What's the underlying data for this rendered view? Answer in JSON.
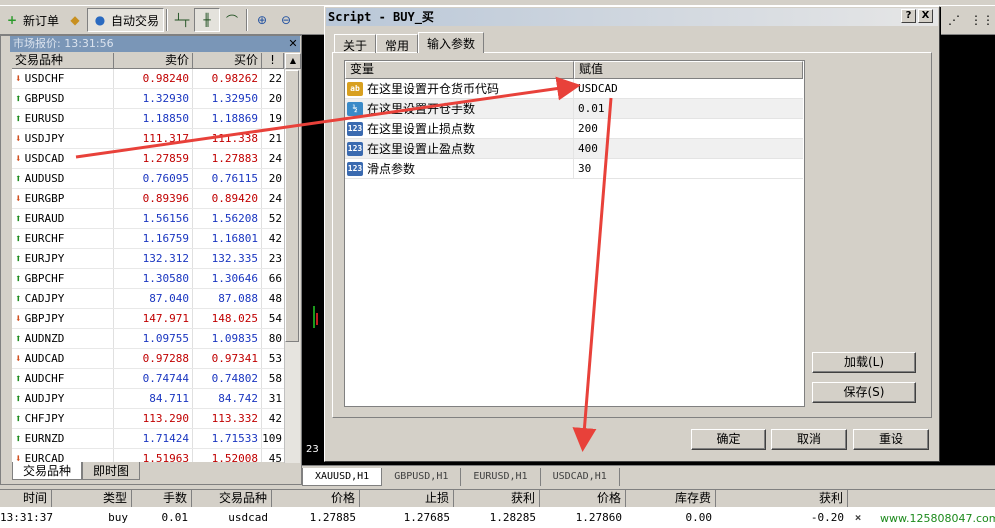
{
  "toolbar": {
    "new_order_label": "新订单",
    "auto_trading_label": "自动交易"
  },
  "market_watch": {
    "title": "市场报价: 13:31:56",
    "columns": [
      "交易品种",
      "卖价",
      "买价",
      "!"
    ],
    "rows": [
      {
        "symbol": "USDCHF",
        "bid": "0.98240",
        "ask": "0.98262",
        "spread": "22",
        "dir": "down",
        "color": "red"
      },
      {
        "symbol": "GBPUSD",
        "bid": "1.32930",
        "ask": "1.32950",
        "spread": "20",
        "dir": "up",
        "color": "blue"
      },
      {
        "symbol": "EURUSD",
        "bid": "1.18850",
        "ask": "1.18869",
        "spread": "19",
        "dir": "up",
        "color": "blue"
      },
      {
        "symbol": "USDJPY",
        "bid": "111.317",
        "ask": "111.338",
        "spread": "21",
        "dir": "down",
        "color": "red"
      },
      {
        "symbol": "USDCAD",
        "bid": "1.27859",
        "ask": "1.27883",
        "spread": "24",
        "dir": "down",
        "color": "red"
      },
      {
        "symbol": "AUDUSD",
        "bid": "0.76095",
        "ask": "0.76115",
        "spread": "20",
        "dir": "up",
        "color": "blue"
      },
      {
        "symbol": "EURGBP",
        "bid": "0.89396",
        "ask": "0.89420",
        "spread": "24",
        "dir": "down",
        "color": "red"
      },
      {
        "symbol": "EURAUD",
        "bid": "1.56156",
        "ask": "1.56208",
        "spread": "52",
        "dir": "up",
        "color": "blue"
      },
      {
        "symbol": "EURCHF",
        "bid": "1.16759",
        "ask": "1.16801",
        "spread": "42",
        "dir": "up",
        "color": "blue"
      },
      {
        "symbol": "EURJPY",
        "bid": "132.312",
        "ask": "132.335",
        "spread": "23",
        "dir": "up",
        "color": "blue"
      },
      {
        "symbol": "GBPCHF",
        "bid": "1.30580",
        "ask": "1.30646",
        "spread": "66",
        "dir": "up",
        "color": "blue"
      },
      {
        "symbol": "CADJPY",
        "bid": "87.040",
        "ask": "87.088",
        "spread": "48",
        "dir": "up",
        "color": "blue"
      },
      {
        "symbol": "GBPJPY",
        "bid": "147.971",
        "ask": "148.025",
        "spread": "54",
        "dir": "down",
        "color": "red"
      },
      {
        "symbol": "AUDNZD",
        "bid": "1.09755",
        "ask": "1.09835",
        "spread": "80",
        "dir": "up",
        "color": "blue"
      },
      {
        "symbol": "AUDCAD",
        "bid": "0.97288",
        "ask": "0.97341",
        "spread": "53",
        "dir": "down",
        "color": "red"
      },
      {
        "symbol": "AUDCHF",
        "bid": "0.74744",
        "ask": "0.74802",
        "spread": "58",
        "dir": "up",
        "color": "blue"
      },
      {
        "symbol": "AUDJPY",
        "bid": "84.711",
        "ask": "84.742",
        "spread": "31",
        "dir": "up",
        "color": "blue"
      },
      {
        "symbol": "CHFJPY",
        "bid": "113.290",
        "ask": "113.332",
        "spread": "42",
        "dir": "up",
        "color": "red"
      },
      {
        "symbol": "EURNZD",
        "bid": "1.71424",
        "ask": "1.71533",
        "spread": "109",
        "dir": "up",
        "color": "blue"
      },
      {
        "symbol": "EURCAD",
        "bid": "1.51963",
        "ask": "1.52008",
        "spread": "45",
        "dir": "down",
        "color": "red"
      }
    ],
    "tabs": [
      "交易品种",
      "即时图"
    ]
  },
  "dialog": {
    "title": "Script - BUY_买",
    "help_label": "?",
    "close_label": "X",
    "tabs": [
      "关于",
      "常用",
      "输入参数"
    ],
    "columns": [
      "变量",
      "赋值"
    ],
    "params": [
      {
        "name": "在这里设置开仓货币代码",
        "value": "USDCAD",
        "icon": "ab"
      },
      {
        "name": "在这里设置开仓手数",
        "value": "0.01",
        "icon": "½"
      },
      {
        "name": "在这里设置止损点数",
        "value": "200",
        "icon": "123"
      },
      {
        "name": "在这里设置止盈点数",
        "value": "400",
        "icon": "123"
      },
      {
        "name": "滑点参数",
        "value": "30",
        "icon": "123"
      }
    ],
    "load_label": "加载(L)",
    "save_label": "保存(S)",
    "ok_label": "确定",
    "cancel_label": "取消",
    "reset_label": "重设"
  },
  "chart_tabs": [
    "XAUUSD,H1",
    "GBPUSD,H1",
    "EURUSD,H1",
    "USDCAD,H1"
  ],
  "chart_side_label": "23",
  "terminal": {
    "columns": [
      "时间",
      "类型",
      "手数",
      "交易品种",
      "价格",
      "止损",
      "获利",
      "价格",
      "库存费",
      "获利"
    ],
    "row": [
      "13:31:37",
      "buy",
      "0.01",
      "usdcad",
      "1.27885",
      "1.27685",
      "1.28285",
      "1.27860",
      "0.00",
      "-0.20"
    ],
    "close_glyph": "×"
  },
  "watermark": "www.125808047.com",
  "colors": {
    "arrow": "#e8413a",
    "up": "#1a8a1a",
    "down": "#d05020",
    "title_bar": "#7a96b7"
  }
}
